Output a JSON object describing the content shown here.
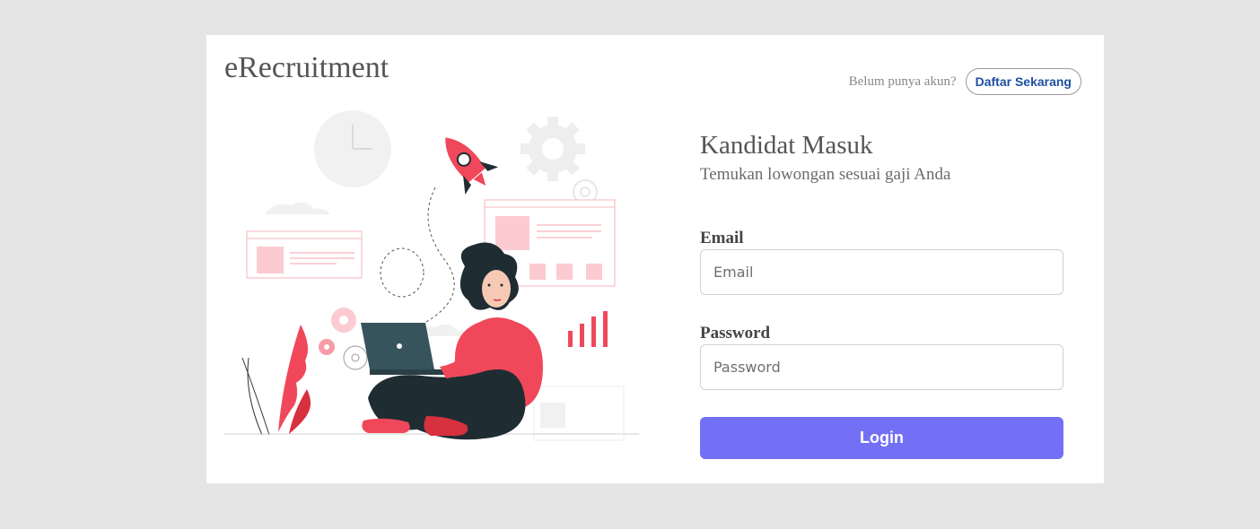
{
  "brand": {
    "name": "eRecruitment"
  },
  "header": {
    "register_prompt": "Belum punya akun?",
    "register_button": "Daftar Sekarang"
  },
  "form": {
    "title": "Kandidat Masuk",
    "subtitle": "Temukan lowongan sesuai gaji Anda",
    "email": {
      "label": "Email",
      "placeholder": "Email",
      "value": ""
    },
    "password": {
      "label": "Password",
      "placeholder": "Password",
      "value": ""
    },
    "login_button": "Login"
  },
  "colors": {
    "page_background": "#e5e5e5",
    "card_background": "#ffffff",
    "accent": "#7370f6",
    "link": "#1e4fa0",
    "illustration_red": "#f0485a",
    "illustration_dark": "#1f2d33"
  },
  "illustration": {
    "name": "woman-working-on-laptop-illustration"
  }
}
